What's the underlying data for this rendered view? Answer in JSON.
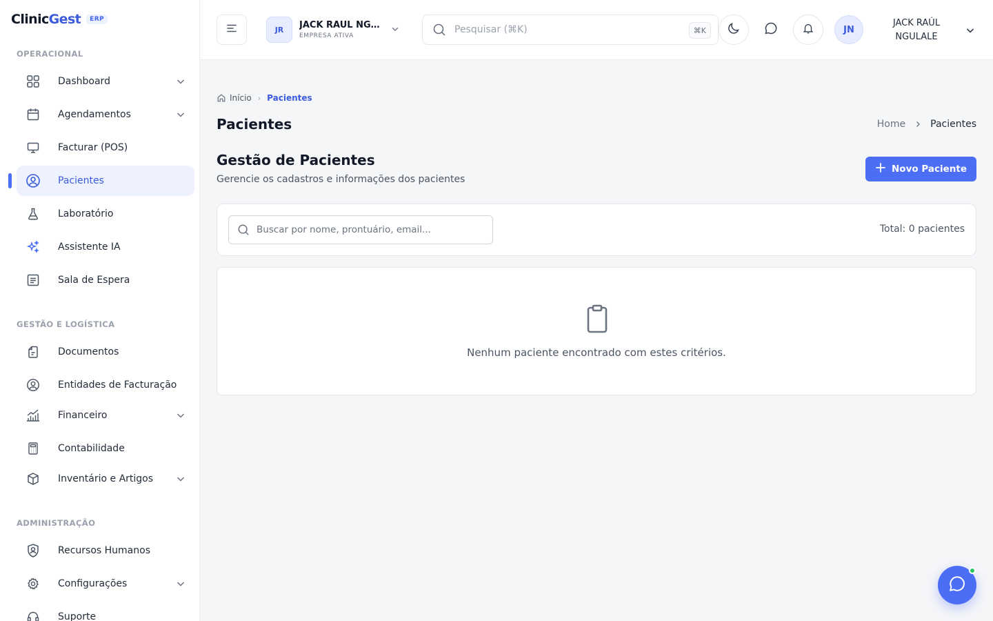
{
  "brand": {
    "name_part1": "Clinic",
    "name_part2": "Gest",
    "badge": "ERP"
  },
  "sidebar": {
    "sections": [
      {
        "label": "OPERACIONAL"
      },
      {
        "label": "GESTÃO E LOGÍSTICA"
      },
      {
        "label": "ADMINISTRAÇÃO"
      }
    ],
    "items": [
      {
        "label": "Dashboard",
        "icon": "grid-icon",
        "has_submenu": true
      },
      {
        "label": "Agendamentos",
        "icon": "calendar-icon",
        "has_submenu": true
      },
      {
        "label": "Facturar (POS)",
        "icon": "monitor-icon",
        "has_submenu": false
      },
      {
        "label": "Pacientes",
        "icon": "user-circle-icon",
        "has_submenu": false,
        "active": true
      },
      {
        "label": "Laboratório",
        "icon": "flask-icon",
        "has_submenu": false
      },
      {
        "label": "Assistente IA",
        "icon": "sparkles-icon",
        "has_submenu": false
      },
      {
        "label": "Sala de Espera",
        "icon": "list-icon",
        "has_submenu": false
      },
      {
        "label": "Documentos",
        "icon": "document-icon",
        "has_submenu": false
      },
      {
        "label": "Entidades de Facturação",
        "icon": "user-circle-icon",
        "has_submenu": false
      },
      {
        "label": "Financeiro",
        "icon": "chart-icon",
        "has_submenu": true
      },
      {
        "label": "Contabilidade",
        "icon": "calculator-icon",
        "has_submenu": false
      },
      {
        "label": "Inventário e Artigos",
        "icon": "box-icon",
        "has_submenu": true
      },
      {
        "label": "Recursos Humanos",
        "icon": "shield-user-icon",
        "has_submenu": false
      },
      {
        "label": "Configurações",
        "icon": "gear-icon",
        "has_submenu": true
      },
      {
        "label": "Suporte",
        "icon": "headset-icon",
        "has_submenu": false
      }
    ]
  },
  "header": {
    "company": {
      "initials": "JR",
      "name": "JACK RAÚL NGULALE",
      "status": "EMPRESA ATIVA"
    },
    "search": {
      "placeholder": "Pesquisar (⌘K)",
      "shortcut": "⌘K"
    },
    "user": {
      "initials": "JN",
      "name": "JACK RAÚL NGULALE"
    }
  },
  "main": {
    "breadcrumb": {
      "home": "Início",
      "current": "Pacientes"
    },
    "page_title": "Pacientes",
    "breadcrumb_right": {
      "home": "Home",
      "current": "Pacientes"
    },
    "section_title": "Gestão de Pacientes",
    "section_subtitle": "Gerencie os cadastros e informações dos pacientes",
    "new_button": "Novo Paciente",
    "filter": {
      "placeholder": "Buscar por nome, prontuário, email...",
      "total": "Total: 0 pacientes"
    },
    "empty_state": "Nenhum paciente encontrado com estes critérios."
  },
  "colors": {
    "accent": "#4c6ef5",
    "active_bg": "#eef2ff",
    "online": "#22c55e"
  }
}
